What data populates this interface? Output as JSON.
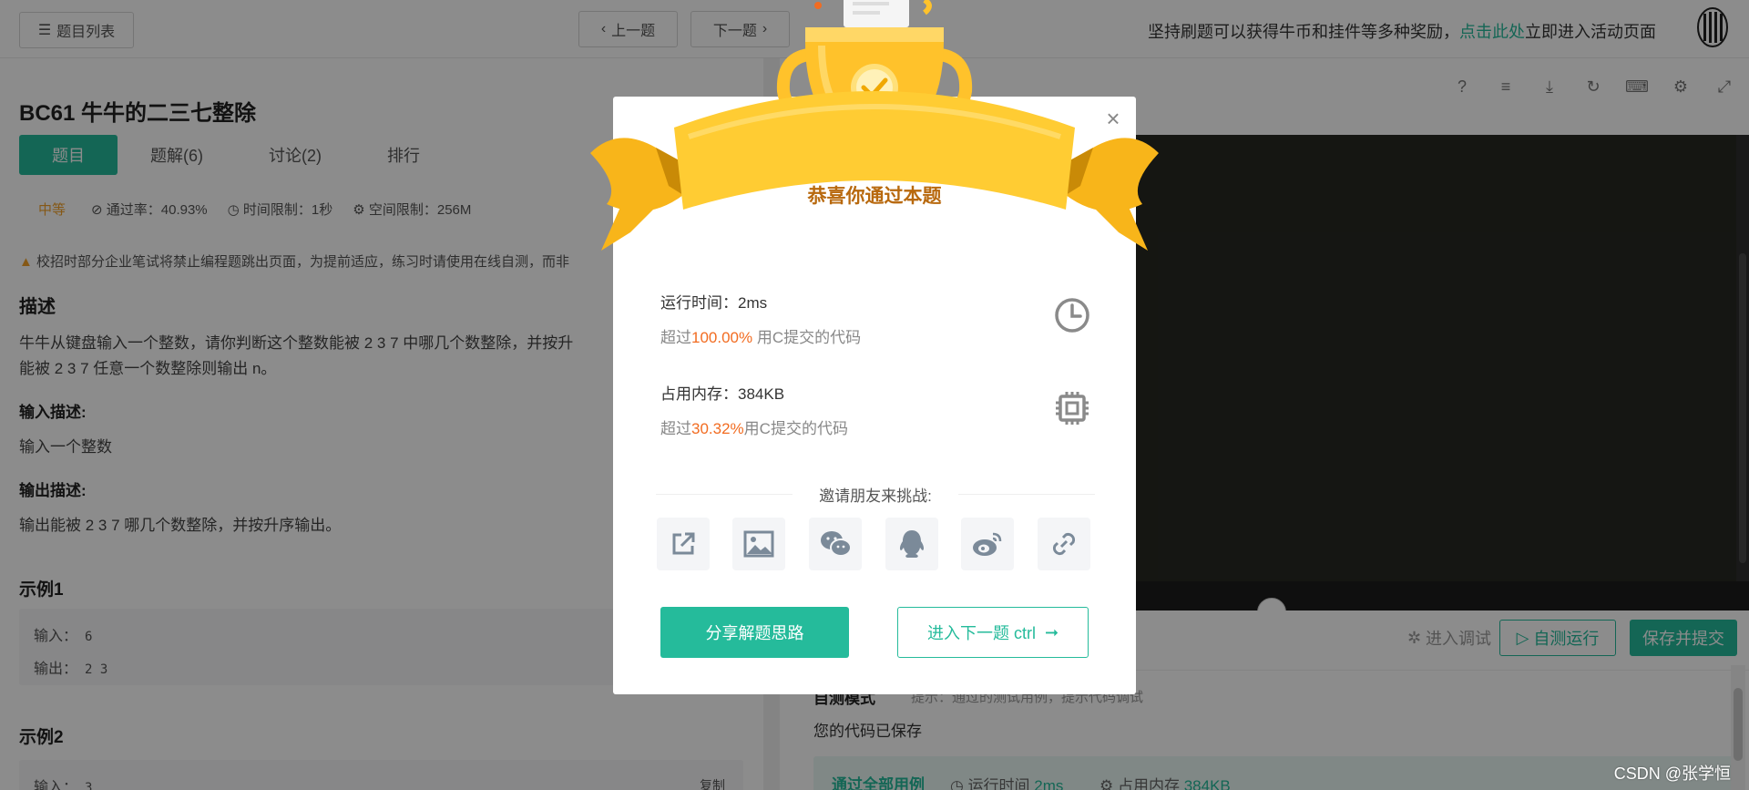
{
  "topbar": {
    "list_label": "题目列表",
    "prev_label": "上一题",
    "next_label": "下一题",
    "promo_prefix": "坚持刷题可以获得牛币和挂件等多种奖励，",
    "promo_link": "点击此处",
    "promo_suffix": "立即进入活动页面"
  },
  "problem": {
    "title": "BC61  牛牛的二三七整除",
    "tabs": [
      "题目",
      "题解(6)",
      "讨论(2)",
      "排行"
    ],
    "difficulty": "中等",
    "pass_rate": "通过率：40.93%",
    "time_limit": "时间限制：1秒",
    "space_limit": "空间限制：256M",
    "notice": "校招时部分企业笔试将禁止编程题跳出页面，为提前适应，练习时请使用在线自测，而非",
    "desc_heading": "描述",
    "desc_line1": "牛牛从键盘输入一个整数，请你判断这个整数能被 2 3 7 中哪几个数整除，并按升",
    "desc_line2": "能被 2 3 7 任意一个数整除则输出 n。",
    "input_heading": "输入描述:",
    "input_text": "输入一个整数",
    "output_heading": "输出描述:",
    "output_text": "输出能被 2 3 7 哪几个数整除，并按升序输出。",
    "example1_heading": "示例1",
    "example1_input_label": "输入：",
    "example1_input": "6",
    "example1_output_label": "输出：",
    "example1_output": "2 3",
    "example2_heading": "示例2",
    "example2_input_label": "输入：",
    "example2_input": "3",
    "copy_label": "复制"
  },
  "actions": {
    "debug_label": "进入调试",
    "selftest_label": "自测运行",
    "submit_label": "保存并提交"
  },
  "output": {
    "tab_label": "自测模式",
    "tip": "提示：通过的测试用例，提示代码调试",
    "saved": "您的代码已保存",
    "result_title": "通过全部用例",
    "runtime_label": "运行时间",
    "runtime_value": "2ms",
    "memory_label": "占用内存",
    "memory_value": "384KB"
  },
  "modal": {
    "congrats": "恭喜你通过本题",
    "runtime_text": "运行时间：2ms",
    "runtime_prefix": "超过",
    "runtime_pct": "100.00%",
    "runtime_suffix": " 用C提交的代码",
    "memory_text": "占用内存：384KB",
    "memory_prefix": "超过",
    "memory_pct": "30.32%",
    "memory_suffix": "用C提交的代码",
    "invite": "邀请朋友来挑战:",
    "share_label": "分享解题思路",
    "next_label": "进入下一题 ctrl"
  },
  "watermark": "CSDN @张学恒",
  "colors": {
    "accent": "#25bb9b",
    "highlight": "#f26c21",
    "difficulty": "#f2a128",
    "trophy": "#ffc22b"
  }
}
